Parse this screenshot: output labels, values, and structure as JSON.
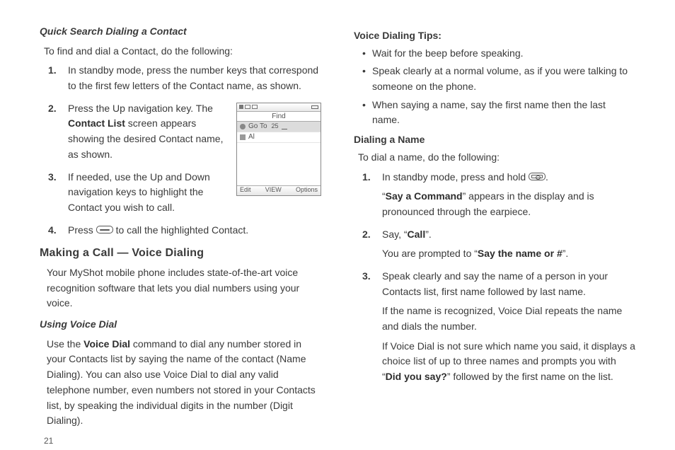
{
  "left": {
    "section1_title": "Quick Search Dialing a Contact",
    "section1_intro": "To find and dial a Contact, do the following:",
    "step1": "In standby mode, press the number keys that correspond to the first few letters of the Contact name, as shown.",
    "step2_a": "Press the Up navigation key. The ",
    "step2_bold": "Contact List",
    "step2_b": " screen appears showing the desired Contact name, as shown.",
    "step3": "If needed, use the Up and Down navigation keys to highlight the Contact you wish to call.",
    "step4_a": "Press ",
    "step4_b": " to call the highlighted Contact.",
    "heading2": "Making a Call — Voice Dialing",
    "heading2_body": "Your MyShot mobile phone includes state-of-the-art voice recognition software that lets you dial numbers using your voice.",
    "section3_title": "Using Voice Dial",
    "section3_body_a": "Use the ",
    "section3_body_bold": "Voice Dial",
    "section3_body_b": " command to dial any number stored in your Contacts list by saying the name of the contact (Name Dialing). You can also use Voice Dial to dial any valid telephone number, even numbers not stored in your Contacts list, by speaking the individual digits in the number (Digit Dialing).",
    "page": "21",
    "fig": {
      "find": "Find",
      "goto": "Go To",
      "num": "25",
      "al": "Al",
      "soft_left": "Edit",
      "soft_mid": "VIEW",
      "soft_right": "Options"
    }
  },
  "right": {
    "tips_title": "Voice Dialing Tips:",
    "tip1": "Wait for the beep before speaking.",
    "tip2": "Speak clearly at a normal volume, as if you were talking to someone on the phone.",
    "tip3": "When saying a name, say the first name then the last name.",
    "dial_title": "Dialing a Name",
    "dial_intro": "To dial a name, do the following:",
    "s1_a": "In standby mode, press and hold ",
    "s1_b": ".",
    "s1_p2_a": "“",
    "s1_p2_bold": "Say a Command",
    "s1_p2_b": "” appears in the display and is pronounced through the earpiece.",
    "s2_a": "Say, “",
    "s2_bold": "Call",
    "s2_b": "”.",
    "s2_p2_a": "You are prompted to “",
    "s2_p2_bold": "Say the name or #",
    "s2_p2_b": "”.",
    "s3_p1": "Speak clearly and say the name of a person in your Contacts list, first name followed by last name.",
    "s3_p2": "If the name is recognized, Voice Dial repeats the name and dials the number.",
    "s3_p3_a": "If Voice Dial is not sure which name you said, it displays a choice list of up to three names and prompts you with “",
    "s3_p3_bold": "Did you say?",
    "s3_p3_b": "” followed by the first name on the list."
  }
}
